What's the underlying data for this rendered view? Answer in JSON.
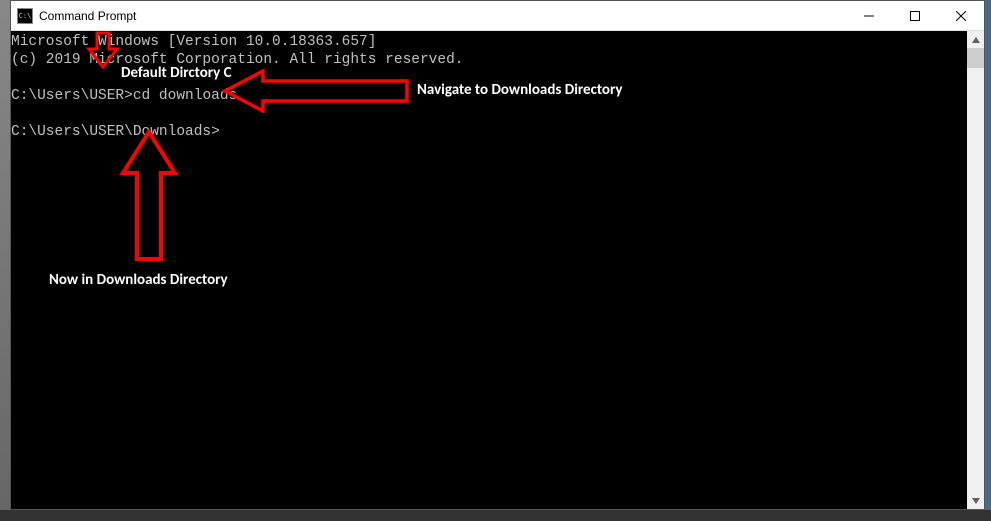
{
  "window": {
    "title": "Command Prompt",
    "icon_glyph": "C:\\"
  },
  "terminal": {
    "line1": "Microsoft Windows [Version 10.0.18363.657]",
    "line2": "(c) 2019 Microsoft Corporation. All rights reserved.",
    "prompt1_path": "C:\\Users\\USER>",
    "prompt1_cmd": "cd downloads",
    "prompt2_path": "C:\\Users\\USER\\Downloads>"
  },
  "annotations": {
    "a1": "Default Dirctory C",
    "a2": "Navigate to Downloads Directory",
    "a3": "Now in Downloads Directory"
  },
  "colors": {
    "arrow": "#ff0000"
  }
}
